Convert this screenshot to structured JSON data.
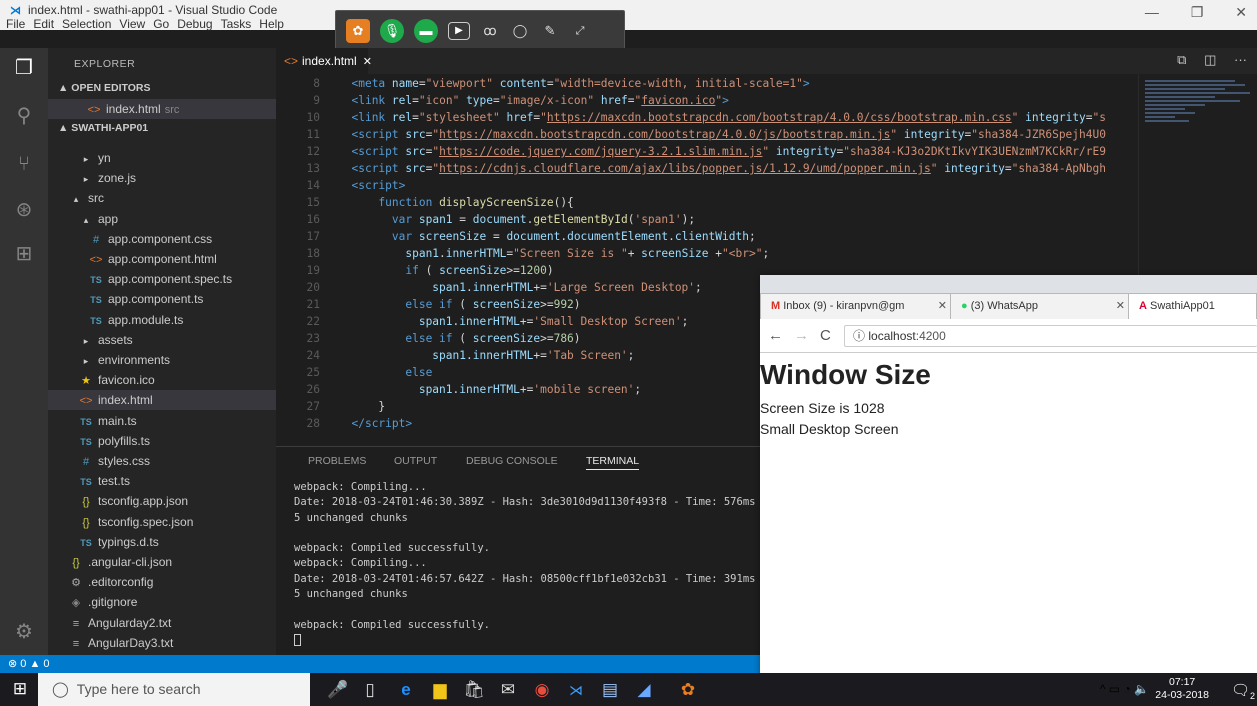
{
  "window": {
    "title": "index.html - swathi-app01 - Visual Studio Code",
    "menu": [
      "File",
      "Edit",
      "Selection",
      "View",
      "Go",
      "Debug",
      "Tasks",
      "Help"
    ],
    "controls": {
      "minimize": "—",
      "restore": "❐",
      "close": "✕"
    }
  },
  "meeting_toolbar": {
    "icons": [
      "app-logo-icon",
      "microphone-icon",
      "chat-icon",
      "video-icon",
      "participants-icon",
      "comment-icon",
      "pen-icon",
      "expand-icon"
    ]
  },
  "sidebar": {
    "title": "EXPLORER",
    "open_editors_label": "▲ OPEN EDITORS",
    "open_editors": [
      {
        "name": "index.html",
        "hint": "src"
      }
    ],
    "project_label": "▲ SWATHI-APP01",
    "tree": [
      {
        "name": "yn",
        "prefix": "▸",
        "indent": 30,
        "icon": ""
      },
      {
        "name": "zone.js",
        "prefix": "▸",
        "indent": 30,
        "icon": ""
      },
      {
        "name": "src",
        "prefix": "▴",
        "indent": 20,
        "icon": ""
      },
      {
        "name": "app",
        "prefix": "▴",
        "indent": 30,
        "icon": ""
      },
      {
        "name": "app.component.css",
        "prefix": "",
        "indent": 40,
        "icon": "#"
      },
      {
        "name": "app.component.html",
        "prefix": "",
        "indent": 40,
        "icon": "<>"
      },
      {
        "name": "app.component.spec.ts",
        "prefix": "",
        "indent": 40,
        "icon": "TS"
      },
      {
        "name": "app.component.ts",
        "prefix": "",
        "indent": 40,
        "icon": "TS"
      },
      {
        "name": "app.module.ts",
        "prefix": "",
        "indent": 40,
        "icon": "TS"
      },
      {
        "name": "assets",
        "prefix": "▸",
        "indent": 30,
        "icon": ""
      },
      {
        "name": "environments",
        "prefix": "▸",
        "indent": 30,
        "icon": ""
      },
      {
        "name": "favicon.ico",
        "prefix": "",
        "indent": 30,
        "icon": "★"
      },
      {
        "name": "index.html",
        "prefix": "",
        "indent": 30,
        "icon": "<>",
        "active": true
      },
      {
        "name": "main.ts",
        "prefix": "",
        "indent": 30,
        "icon": "TS"
      },
      {
        "name": "polyfills.ts",
        "prefix": "",
        "indent": 30,
        "icon": "TS"
      },
      {
        "name": "styles.css",
        "prefix": "",
        "indent": 30,
        "icon": "#"
      },
      {
        "name": "test.ts",
        "prefix": "",
        "indent": 30,
        "icon": "TS"
      },
      {
        "name": "tsconfig.app.json",
        "prefix": "",
        "indent": 30,
        "icon": "{}"
      },
      {
        "name": "tsconfig.spec.json",
        "prefix": "",
        "indent": 30,
        "icon": "{}"
      },
      {
        "name": "typings.d.ts",
        "prefix": "",
        "indent": 30,
        "icon": "TS"
      },
      {
        "name": ".angular-cli.json",
        "prefix": "",
        "indent": 20,
        "icon": "{}"
      },
      {
        "name": ".editorconfig",
        "prefix": "",
        "indent": 20,
        "icon": "⚙"
      },
      {
        "name": ".gitignore",
        "prefix": "",
        "indent": 20,
        "icon": "◈"
      },
      {
        "name": "Angularday2.txt",
        "prefix": "",
        "indent": 20,
        "icon": "≡"
      },
      {
        "name": "AngularDay3.txt",
        "prefix": "",
        "indent": 20,
        "icon": "≡"
      }
    ]
  },
  "editor": {
    "tab_label": "index.html",
    "tab_close": "✕",
    "lines": [
      {
        "n": "8",
        "html": "  <span class=\"tg\">&lt;meta</span> <span class=\"at\">name</span>=<span class=\"st\">\"viewport\"</span> <span class=\"at\">content</span>=<span class=\"st\">\"width=device-width, initial-scale=1\"</span><span class=\"tg\">&gt;</span>"
      },
      {
        "n": "9",
        "html": "  <span class=\"tg\">&lt;link</span> <span class=\"at\">rel</span>=<span class=\"st\">\"icon\"</span> <span class=\"at\">type</span>=<span class=\"st\">\"image/x-icon\"</span> <span class=\"at\">href</span>=<span class=\"st\">\"<span class=\"ul\">favicon.ico</span>\"</span><span class=\"tg\">&gt;</span>"
      },
      {
        "n": "10",
        "html": "  <span class=\"tg\">&lt;link</span> <span class=\"at\">rel</span>=<span class=\"st\">\"stylesheet\"</span> <span class=\"at\">href</span>=<span class=\"st\">\"<span class=\"ul\">https://maxcdn.bootstrapcdn.com/bootstrap/4.0.0/css/bootstrap.min.css</span>\"</span> <span class=\"at\">integrity</span>=<span class=\"st\">\"s</span>"
      },
      {
        "n": "11",
        "html": "  <span class=\"tg\">&lt;script</span> <span class=\"at\">src</span>=<span class=\"st\">\"<span class=\"ul\">https://maxcdn.bootstrapcdn.com/bootstrap/4.0.0/js/bootstrap.min.js</span>\"</span> <span class=\"at\">integrity</span>=<span class=\"st\">\"sha384-JZR6Spejh4U0</span>"
      },
      {
        "n": "12",
        "html": "  <span class=\"tg\">&lt;script</span> <span class=\"at\">src</span>=<span class=\"st\">\"<span class=\"ul\">https://code.jquery.com/jquery-3.2.1.slim.min.js</span>\"</span> <span class=\"at\">integrity</span>=<span class=\"st\">\"sha384-KJ3o2DKtIkvYIK3UENzmM7KCkRr/rE9</span>"
      },
      {
        "n": "13",
        "html": "  <span class=\"tg\">&lt;script</span> <span class=\"at\">src</span>=<span class=\"st\">\"<span class=\"ul\">https://cdnjs.cloudflare.com/ajax/libs/popper.js/1.12.9/umd/popper.min.js</span>\"</span> <span class=\"at\">integrity</span>=<span class=\"st\">\"sha384-ApNbgh</span>"
      },
      {
        "n": "14",
        "html": "  <span class=\"tg\">&lt;script&gt;</span>"
      },
      {
        "n": "15",
        "html": "      <span class=\"kw\">function</span> <span class=\"fn\">displayScreenSize</span>(){"
      },
      {
        "n": "16",
        "html": "        <span class=\"kw\">var</span> <span class=\"vr\">span1</span> = <span class=\"vr\">document</span>.<span class=\"fn\">getElementById</span>(<span class=\"st\">'span1'</span>);"
      },
      {
        "n": "17",
        "html": "        <span class=\"kw\">var</span> <span class=\"vr\">screenSize</span> = <span class=\"vr\">document</span>.<span class=\"vr\">documentElement</span>.<span class=\"vr\">clientWidth</span>;"
      },
      {
        "n": "18",
        "html": "          <span class=\"vr\">span1</span>.<span class=\"vr\">innerHTML</span>=<span class=\"st\">\"Screen Size is \"</span>+ <span class=\"vr\">screenSize</span> +<span class=\"st\">\"&lt;br&gt;\"</span>;"
      },
      {
        "n": "19",
        "html": "          <span class=\"kw\">if</span> ( <span class=\"vr\">screenSize</span>&gt;=<span class=\"nm\">1200</span>)"
      },
      {
        "n": "20",
        "html": "              <span class=\"vr\">span1</span>.<span class=\"vr\">innerHTML</span>+=<span class=\"st\">'Large Screen Desktop'</span>;"
      },
      {
        "n": "21",
        "html": "          <span class=\"kw\">else if</span> ( <span class=\"vr\">screenSize</span>&gt;=<span class=\"nm\">992</span>)"
      },
      {
        "n": "22",
        "html": "            <span class=\"vr\">span1</span>.<span class=\"vr\">innerHTML</span>+=<span class=\"st\">'Small Desktop Screen'</span>;"
      },
      {
        "n": "23",
        "html": "          <span class=\"kw\">else if</span> ( <span class=\"vr\">screenSize</span>&gt;=<span class=\"nm\">786</span>)"
      },
      {
        "n": "24",
        "html": "              <span class=\"vr\">span1</span>.<span class=\"vr\">innerHTML</span>+=<span class=\"st\">'Tab Screen'</span>;"
      },
      {
        "n": "25",
        "html": "          <span class=\"kw\">else</span>"
      },
      {
        "n": "26",
        "html": "            <span class=\"vr\">span1</span>.<span class=\"vr\">innerHTML</span>+=<span class=\"st\">'mobile screen'</span>;"
      },
      {
        "n": "27",
        "html": "      }"
      },
      {
        "n": "28",
        "html": "  <span class=\"tg\">&lt;/script&gt;</span>"
      }
    ]
  },
  "panel": {
    "tabs": [
      "PROBLEMS",
      "OUTPUT",
      "DEBUG CONSOLE",
      "TERMINAL"
    ],
    "active_tab": "TERMINAL",
    "terminal_lines": [
      "webpack: Compiling...",
      "Date: 2018-03-24T01:46:30.389Z - Hash: 3de3010d9d1130f493f8 - Time: 576ms",
      "5 unchanged chunks",
      "",
      "webpack: Compiled successfully.",
      "webpack: Compiling...",
      "Date: 2018-03-24T01:46:57.642Z - Hash: 08500cff1bf1e032cb31 - Time: 391ms",
      "5 unchanged chunks",
      "",
      "webpack: Compiled successfully."
    ]
  },
  "statusbar": {
    "problems": "⊗ 0 ▲ 0"
  },
  "browser": {
    "tabs": [
      {
        "label": "Inbox (9) - kiranpvn@gm",
        "icon": "M",
        "icon_color": "#d93025"
      },
      {
        "label": "(3) WhatsApp",
        "icon": "●",
        "icon_color": "#25d366"
      },
      {
        "label": "SwathiApp01",
        "icon": "A",
        "icon_color": "#dd0031",
        "active": true
      }
    ],
    "tab_close": "✕",
    "nav": {
      "back": "←",
      "forward": "→",
      "reload": "C"
    },
    "url_host": "localhost",
    "url_port": ":4200",
    "page": {
      "heading": "Window Size",
      "screen_size_text": "Screen Size is 1028",
      "screen_label": "Small Desktop Screen"
    }
  },
  "taskbar": {
    "search_placeholder": "Type here to search",
    "time": "07:17",
    "date": "24-03-2018",
    "tray_icons": "^ ▭ ◔ 🔈",
    "notification_count": "2"
  },
  "colors": {
    "vscode_blue": "#007acc",
    "activity_bar": "#333333",
    "sidebar": "#252526",
    "editor_bg": "#1e1e1e"
  }
}
